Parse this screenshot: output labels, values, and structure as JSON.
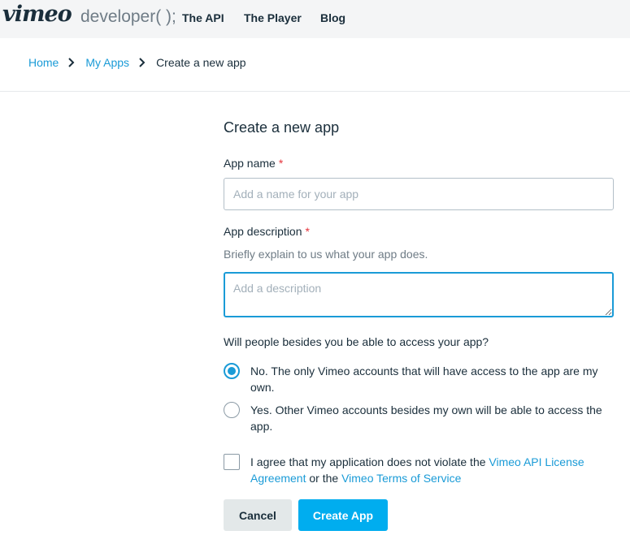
{
  "header": {
    "logo": "vimeo",
    "developer": "developer( );",
    "nav": [
      "The API",
      "The Player",
      "Blog"
    ]
  },
  "breadcrumb": {
    "home": "Home",
    "my_apps": "My Apps",
    "current": "Create a new app"
  },
  "form": {
    "title": "Create a new app",
    "app_name_label": "App name",
    "required_mark": "*",
    "app_name_placeholder": "Add a name for your app",
    "app_name_value": "",
    "description_label": "App description",
    "description_help": "Briefly explain to us what your app does.",
    "description_placeholder": "Add a description",
    "description_value": "",
    "access_question": "Will people besides you be able to access your app?",
    "access_options": [
      {
        "label": "No. The only Vimeo accounts that will have access to the app are my own.",
        "selected": true
      },
      {
        "label": "Yes. Other Vimeo accounts besides my own will be able to access the app.",
        "selected": false
      }
    ],
    "agreement": {
      "checked": false,
      "text_before": "I agree that my application does not violate the ",
      "link1": "Vimeo API License Agreement",
      "text_middle": " or the ",
      "link2": "Vimeo Terms of Service"
    },
    "cancel_label": "Cancel",
    "create_label": "Create App"
  },
  "colors": {
    "accent": "#1a9bd7",
    "button_primary": "#00adef",
    "required": "#e5343c"
  }
}
